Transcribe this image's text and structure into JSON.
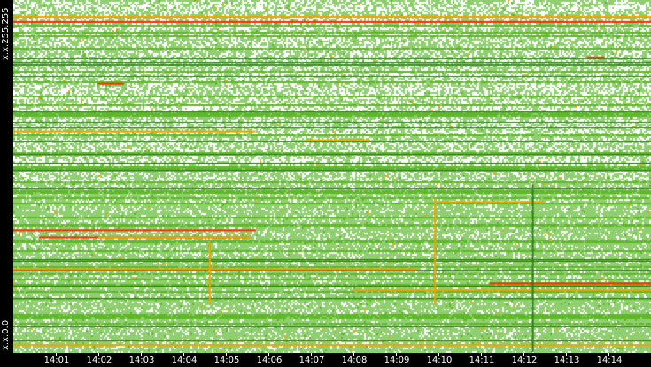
{
  "chart_data": {
    "type": "heatmap",
    "title": "",
    "xlabel": "",
    "ylabel": "",
    "x_range_minutes": [
      0,
      15
    ],
    "x_start": "14:00",
    "x_ticks": [
      "14:01",
      "14:02",
      "14:03",
      "14:04",
      "14:05",
      "14:06",
      "14:07",
      "14:08",
      "14:09",
      "14:10",
      "14:11",
      "14:12",
      "14:13",
      "14:14"
    ],
    "y_labels": {
      "top": "x.x.255.255",
      "bottom": "x.x.0.0"
    },
    "rows": 200,
    "colors": {
      "empty": "#ffffff",
      "low": "#8fcf6f",
      "mid": "#5fb82a",
      "dark": "#2e7d1a",
      "high": "#f5a000",
      "peak": "#ff2a00"
    },
    "streaks": [
      {
        "row": 187,
        "from": 0,
        "to": 15,
        "level": "peak"
      },
      {
        "row": 125,
        "from": 0,
        "to": 5.7,
        "level": "high"
      },
      {
        "row": 120,
        "from": 6.9,
        "to": 8.4,
        "level": "high"
      },
      {
        "row": 69,
        "from": 0,
        "to": 5.7,
        "level": "peak"
      },
      {
        "row": 65,
        "from": 0.6,
        "to": 5.5,
        "level": "peak"
      },
      {
        "row": 65,
        "from": 2,
        "to": 5.6,
        "level": "high"
      },
      {
        "row": 85,
        "from": 10,
        "to": 12.5,
        "level": "high"
      },
      {
        "row": 39,
        "from": 11.2,
        "to": 15,
        "level": "peak"
      },
      {
        "row": 35,
        "from": 8,
        "to": 15,
        "level": "high"
      },
      {
        "row": 47,
        "from": 0,
        "to": 9.5,
        "level": "high"
      },
      {
        "row": 4,
        "from": 0,
        "to": 15,
        "level": "high"
      },
      {
        "row": 190,
        "from": 0,
        "to": 15,
        "level": "high"
      },
      {
        "row": 152,
        "from": 2,
        "to": 2.6,
        "level": "peak"
      },
      {
        "row": 167,
        "from": 13.5,
        "to": 13.9,
        "level": "peak"
      }
    ],
    "vertical_bursts": [
      {
        "time": 4.6,
        "row_from": 27,
        "row_to": 62,
        "level": "high"
      },
      {
        "time": 9.9,
        "row_from": 27,
        "row_to": 87,
        "level": "high"
      },
      {
        "time": 12.2,
        "row_from": 0,
        "row_to": 95,
        "level": "dark"
      }
    ]
  }
}
